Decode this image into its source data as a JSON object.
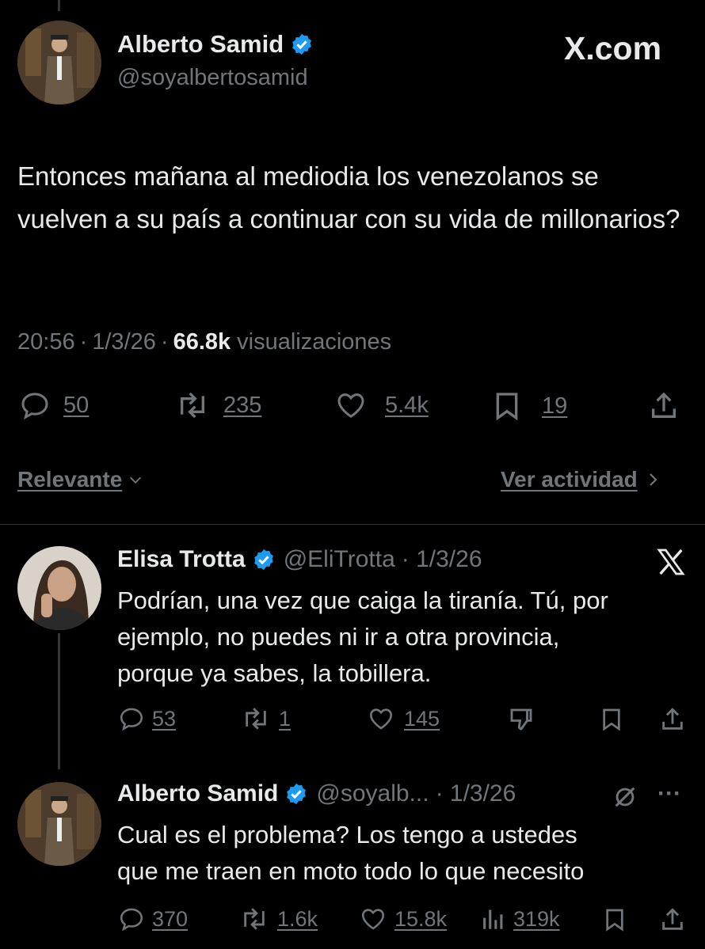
{
  "watermark": "X.com",
  "main_tweet": {
    "author_name": "Alberto Samid",
    "handle": "@soyalbertosamid",
    "text": "Entonces mañana al mediodia los venezolanos se vuelven a su país a continuar con su vida de millonarios?",
    "time": "20:56",
    "date": "1/3/26",
    "sep": "·",
    "views_count": "66.8k",
    "views_label": "visualizaciones",
    "stats": {
      "replies": "50",
      "reposts": "235",
      "likes": "5.4k",
      "bookmarks": "19"
    }
  },
  "sort": {
    "label": "Relevante",
    "activity_label": "Ver actividad"
  },
  "reply1": {
    "author_name": "Elisa Trotta",
    "handle": "@EliTrotta",
    "date": "· 1/3/26",
    "text_lines": [
      "Podrían, una vez que caiga la tiranía. Tú, por",
      "ejemplo, no puedes ni ir a otra provincia,",
      "porque ya sabes, la tobillera."
    ],
    "stats": {
      "replies": "53",
      "reposts": "1",
      "likes": "145"
    }
  },
  "reply2": {
    "author_name": "Alberto Samid",
    "handle": "@soyalb...",
    "date": "· 1/3/26",
    "more": "···",
    "text_lines": [
      "Cual es el problema? Los tengo a ustedes",
      "que me traen en moto todo lo que necesito"
    ],
    "stats": {
      "replies": "370",
      "reposts": "1.6k",
      "likes": "15.8k",
      "views": "319k"
    }
  },
  "colors": {
    "verified": "#1d9bf0",
    "muted": "#71767b",
    "text": "#e7e9ea",
    "divider": "#2f3336"
  }
}
